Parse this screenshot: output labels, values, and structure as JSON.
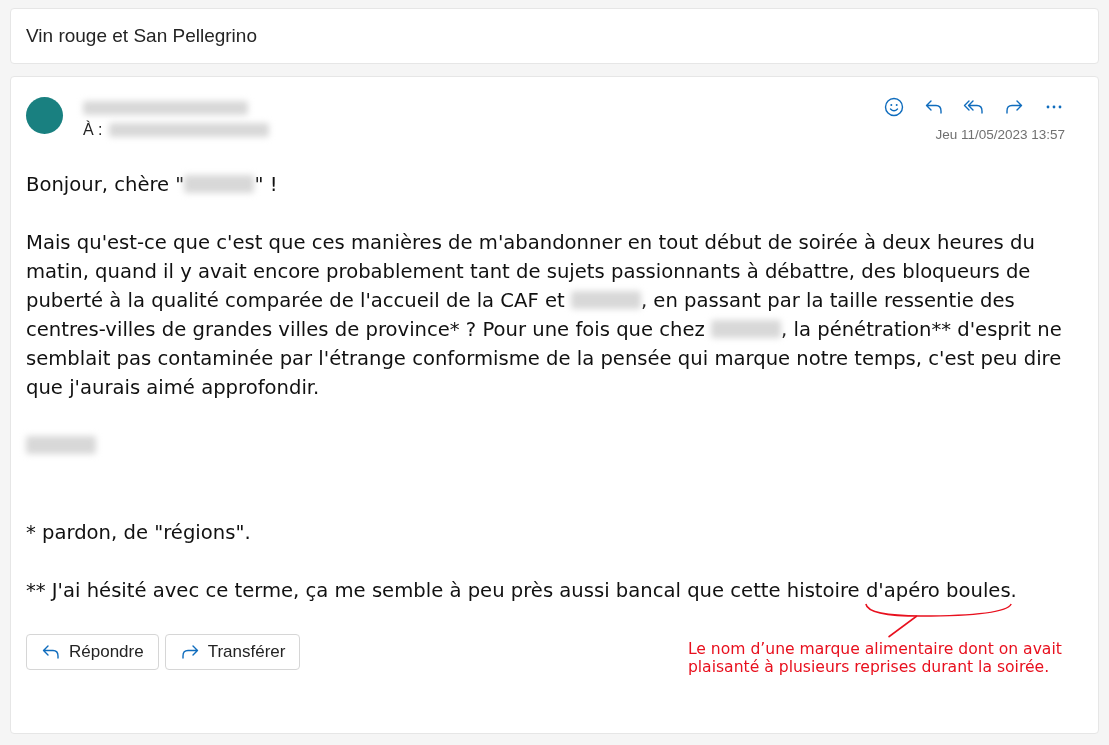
{
  "subject": "Vin rouge et San Pellegrino",
  "message": {
    "to_label": "À :",
    "date": "Jeu 11/05/2023 13:57",
    "actions": [
      {
        "kind": "emoji"
      },
      {
        "kind": "reply"
      },
      {
        "kind": "reply_all"
      },
      {
        "kind": "forward"
      },
      {
        "kind": "more"
      }
    ],
    "body": [
      {
        "kind": "text",
        "segments": [
          {
            "kind": "text",
            "text": "Bonjour, chère \""
          },
          {
            "kind": "redacted"
          },
          {
            "kind": "text",
            "text": "\" !"
          }
        ]
      },
      {
        "kind": "text",
        "segments": [
          {
            "kind": "text",
            "text": "Mais qu'est-ce que c'est que ces manières de m'abandonner en tout début de soirée à deux heures du matin, quand il y avait encore probablement tant de sujets passionnants à débattre, des bloqueurs de puberté à la qualité comparée de l'accueil de la CAF et "
          },
          {
            "kind": "redacted"
          },
          {
            "kind": "text",
            "text": ", en passant par la taille ressentie des centres-villes de grandes villes de province* ? Pour une fois que chez "
          },
          {
            "kind": "redacted"
          },
          {
            "kind": "text",
            "text": ", la pénétration** d'esprit ne semblait pas contaminée par l'étrange conformisme de la pensée qui marque notre temps, c'est peu dire que j'aurais aimé approfondir."
          }
        ]
      },
      {
        "kind": "signature",
        "segments": [
          {
            "kind": "redacted"
          }
        ]
      },
      {
        "kind": "text",
        "segments": [
          {
            "kind": "text",
            "text": "* pardon, de \"régions\"."
          }
        ]
      },
      {
        "kind": "text",
        "segments": [
          {
            "kind": "text",
            "text": "** J'ai hésité avec ce terme, ça me semble à peu près aussi bancal que cette histoire "
          },
          {
            "kind": "marked",
            "text": "d'apéro boules.",
            "annotation": "Le nom d’une marque alimentaire dont on avait plaisanté à plusieurs reprises durant la soirée."
          }
        ]
      }
    ],
    "buttons": [
      {
        "kind": "reply",
        "label": "Répondre"
      },
      {
        "kind": "forward",
        "label": "Transférer"
      }
    ]
  }
}
